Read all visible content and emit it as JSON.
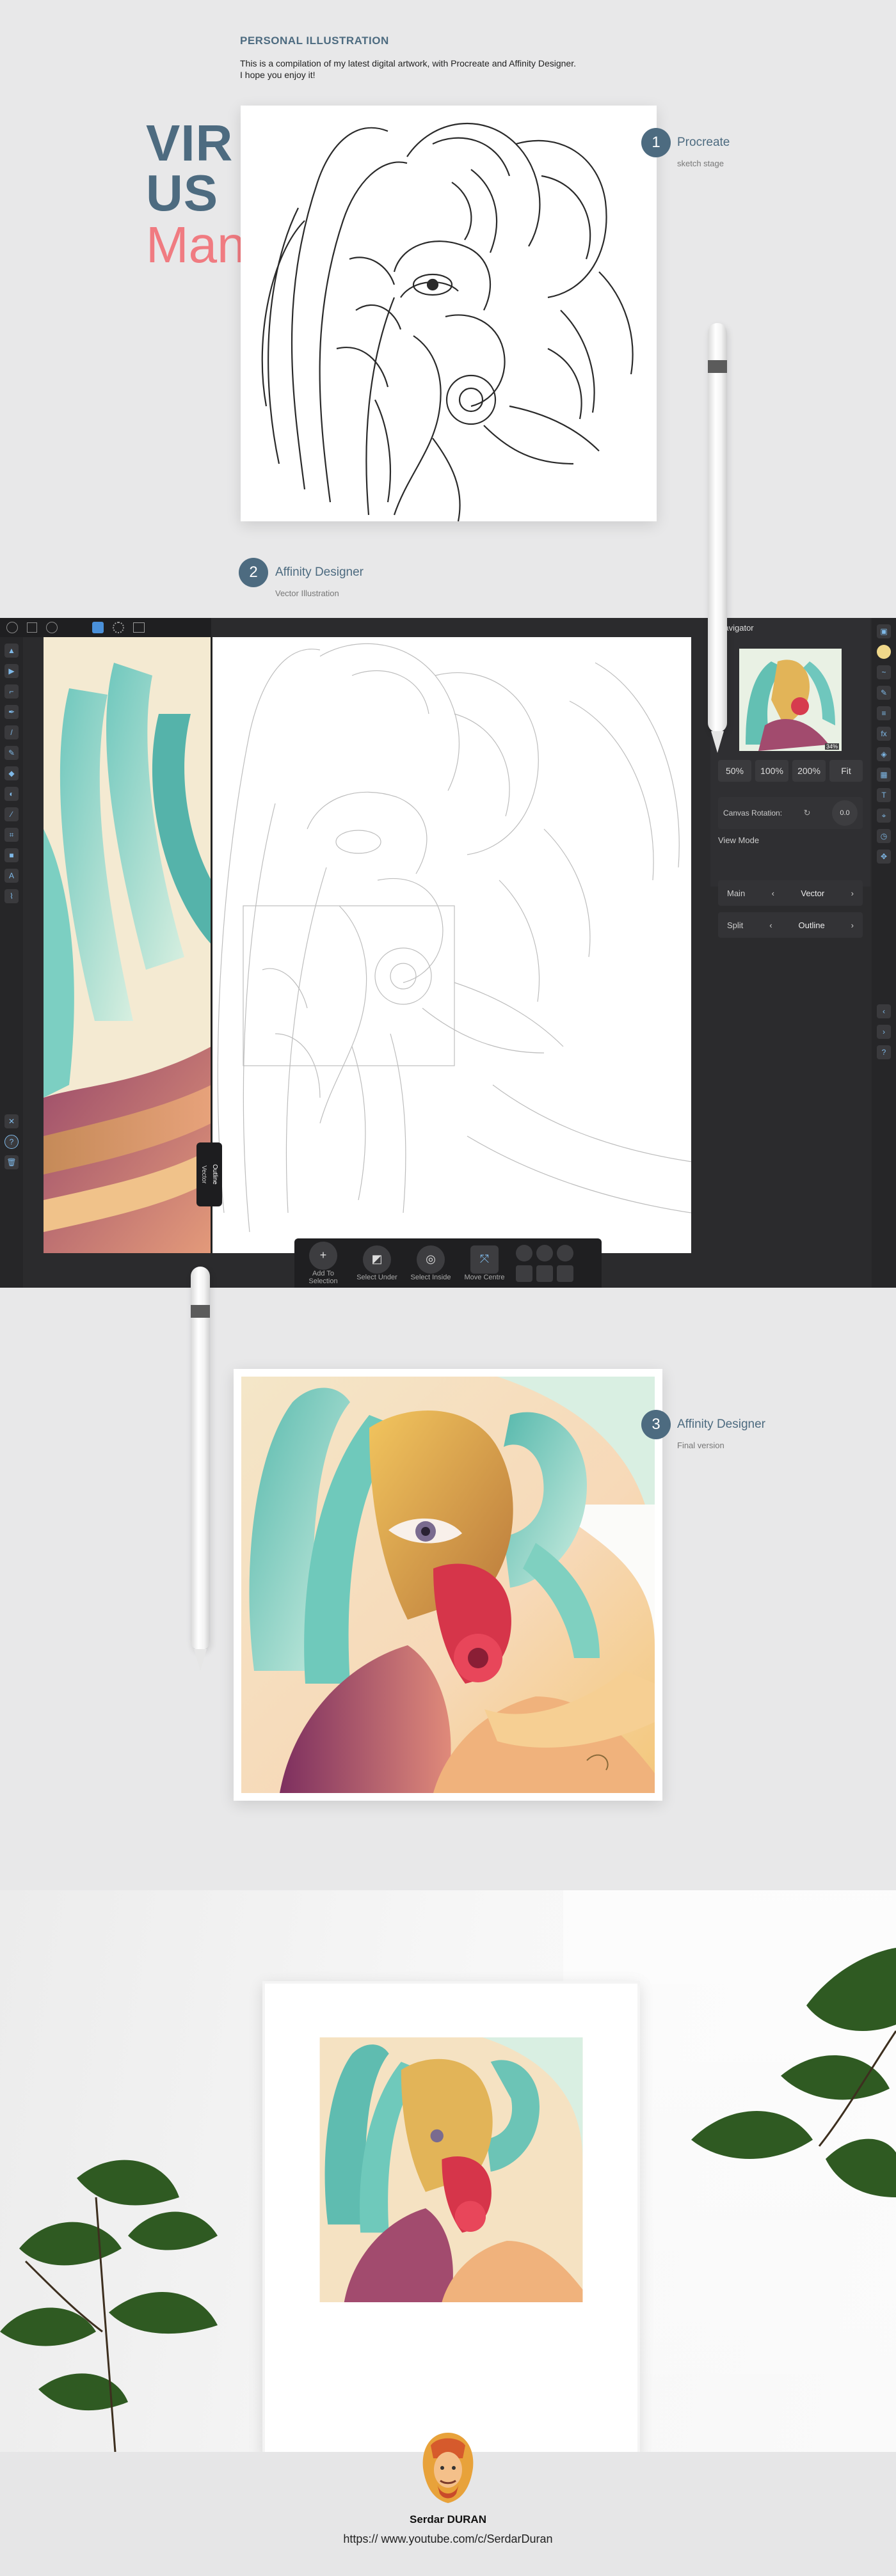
{
  "header": {
    "eyebrow": "PERSONAL ILLUSTRATION",
    "intro_line1": "This is a compilation of my latest digital artwork, with Procreate and Affinity Designer.",
    "intro_line2": "I hope you enjoy it!",
    "title_1": "VIR",
    "title_2": "US",
    "title_3": "Man"
  },
  "steps": [
    {
      "number": "1",
      "title": "Procreate",
      "subtitle": "sketch stage"
    },
    {
      "number": "2",
      "title": "Affinity Designer",
      "subtitle": "Vector Illustration"
    },
    {
      "number": "3",
      "title": "Affinity Designer",
      "subtitle": "Final version"
    }
  ],
  "app": {
    "navigator_title": "Navigator",
    "zoom_buttons": [
      "50%",
      "100%",
      "200%",
      "Fit"
    ],
    "thumb_zoom": "34%",
    "canvas_rotation_label": "Canvas Rotation:",
    "canvas_rotation_value": "0.0",
    "view_mode_label": "View Mode",
    "main_label": "Main",
    "main_value": "Vector",
    "split_label": "Split",
    "split_value": "Outline",
    "split_tab_1": "Outline",
    "split_tab_2": "Vector",
    "bottom_actions": [
      "Add To Selection",
      "Select Under",
      "Select Inside",
      "Move Centre"
    ]
  },
  "footer": {
    "name": "Serdar DURAN",
    "url": "https:// www.youtube.com/c/SerdarDuran"
  },
  "colors": {
    "accent": "#4d6b80",
    "pink": "#f07b81",
    "app_bg": "#2b2b2d"
  }
}
